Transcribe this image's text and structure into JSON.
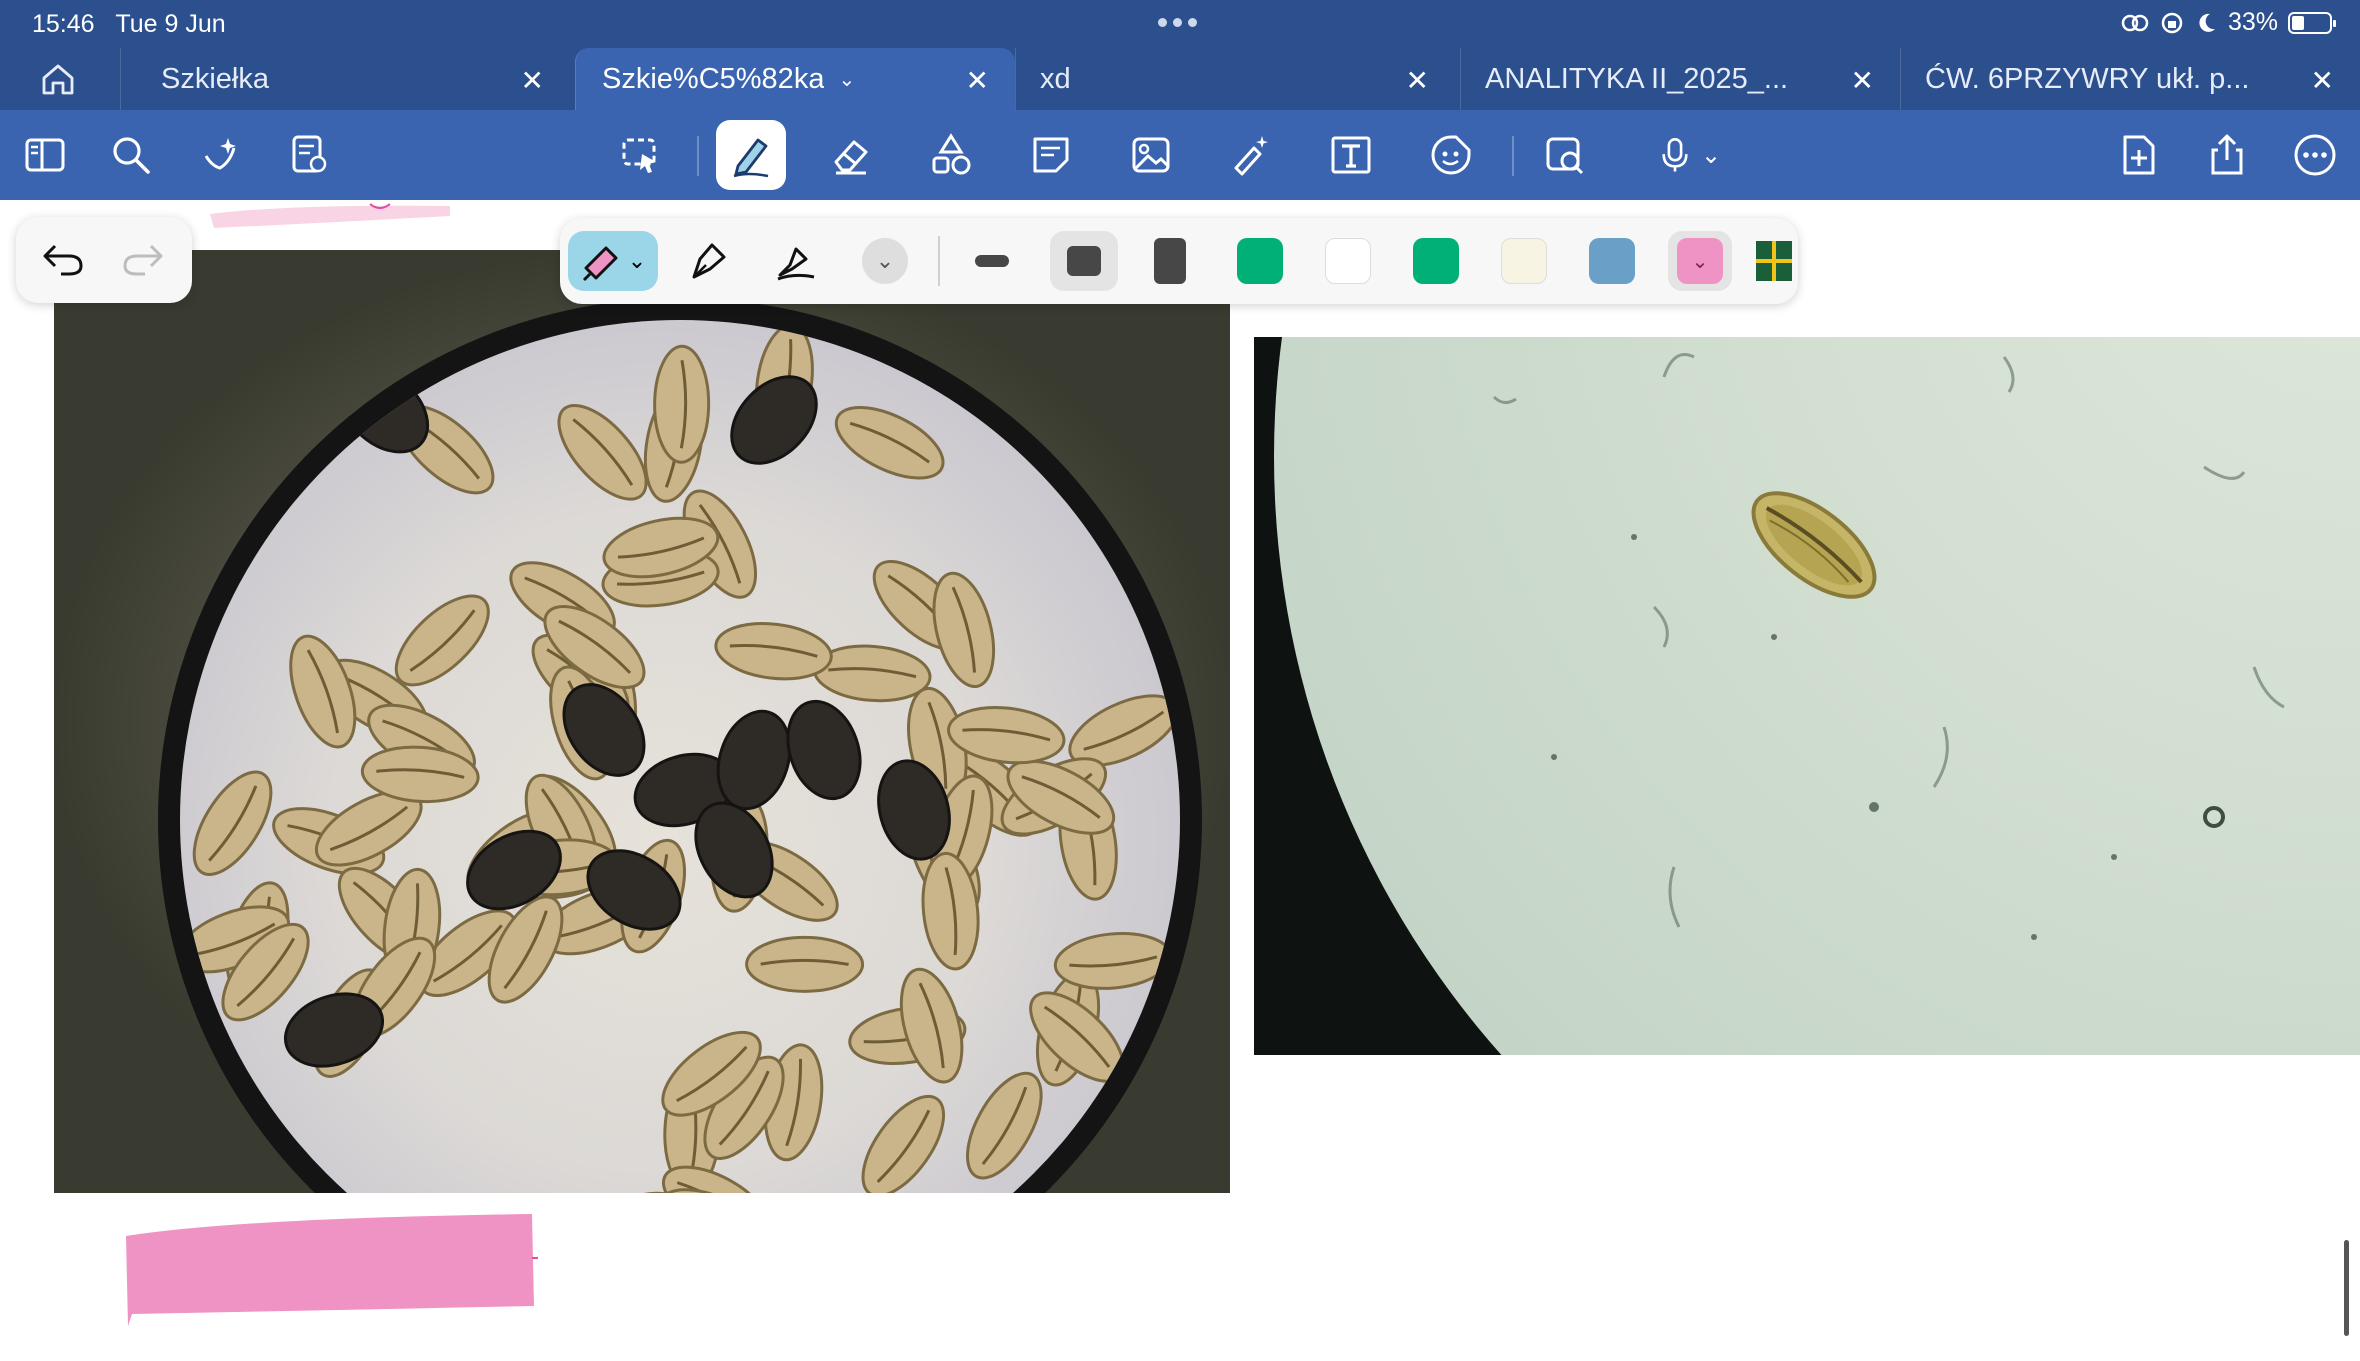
{
  "status_bar": {
    "time": "15:46",
    "date": "Tue 9 Jun",
    "battery_percent": "33%",
    "battery_level": 0.33
  },
  "tabs": [
    {
      "label": "Szkiełka",
      "active": false
    },
    {
      "label": "Szkie%C5%82ka",
      "active": true
    },
    {
      "label": "xd",
      "active": false
    },
    {
      "label": "ANALITYKA II_2025_...",
      "active": false
    },
    {
      "label": "ĆW. 6PRZYWRY ukł. p...",
      "active": false
    }
  ],
  "toolbar_icons": [
    "sidebar-icon",
    "search-icon",
    "sparkle-icon",
    "document-review-icon",
    "lasso-icon",
    "pen-icon",
    "eraser-icon",
    "shapes-icon",
    "sticky-note-icon",
    "image-icon",
    "highlighter-magic-icon",
    "text-box-icon",
    "sticker-icon",
    "image-search-icon",
    "microphone-icon",
    "new-page-icon",
    "share-icon",
    "more-icon"
  ],
  "pen_panel": {
    "tools": [
      "highlighter-icon",
      "fountain-pen-icon",
      "brush-pen-icon"
    ],
    "colors": [
      "#474747",
      "#474747",
      "#00b077",
      "#ffffff",
      "#00b077",
      "#f7f4e4",
      "#6aa0c8",
      "#ef93c4"
    ],
    "selected_color": "#ef93c4",
    "accent": "#3a64b0",
    "brand": "#2c4f8e"
  }
}
